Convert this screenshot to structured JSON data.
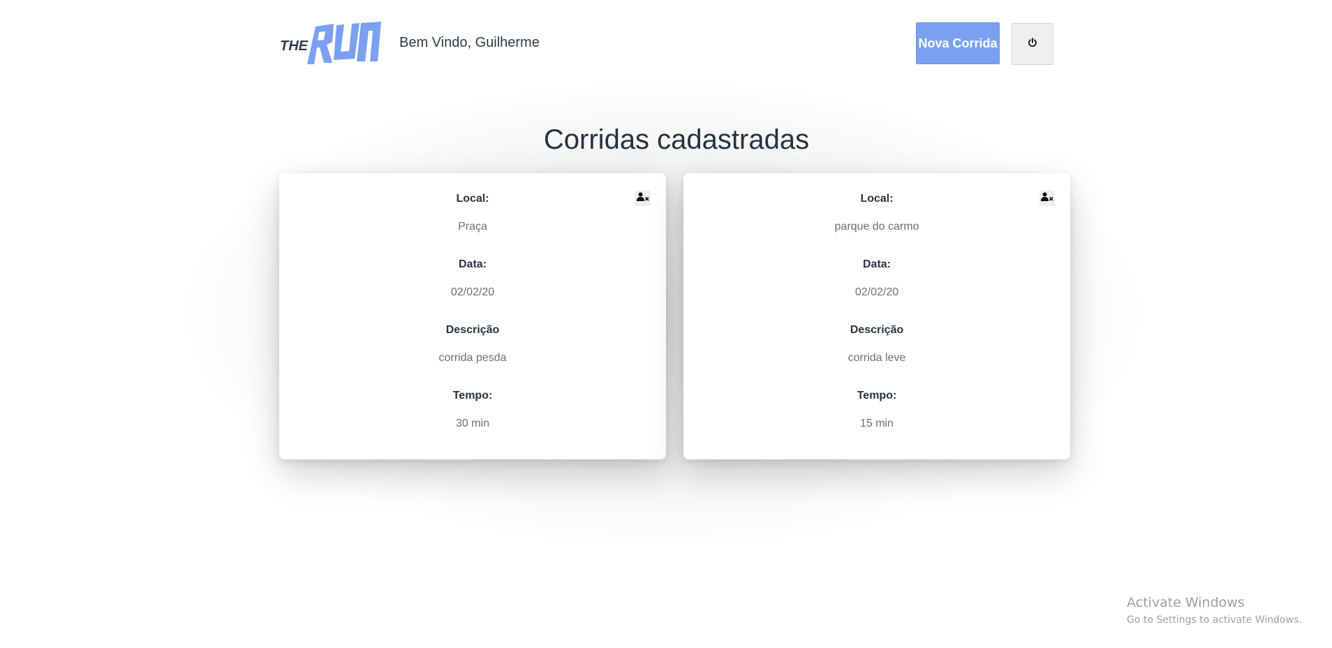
{
  "header": {
    "logo_text": "THE RUN",
    "welcome": "Bem Vindo, Guilherme",
    "new_run_label": "Nova Corrida",
    "logout_icon": "power-icon"
  },
  "colors": {
    "accent": "#7ba0f0",
    "text": "#2b3440",
    "muted": "#6b6f75"
  },
  "main": {
    "title": "Corridas cadastradas",
    "labels": {
      "local": "Local:",
      "data": "Data:",
      "descricao": "Descrição",
      "tempo": "Tempo:"
    },
    "runs": [
      {
        "local": "Praça",
        "data": "02/02/20",
        "descricao": "corrida pesda",
        "tempo": "30 min",
        "delete_icon": "remove-user-icon"
      },
      {
        "local": "parque do carmo",
        "data": "02/02/20",
        "descricao": "corrida leve",
        "tempo": "15 min",
        "delete_icon": "remove-user-icon"
      }
    ]
  },
  "watermark": {
    "line1": "Activate Windows",
    "line2": "Go to Settings to activate Windows."
  }
}
